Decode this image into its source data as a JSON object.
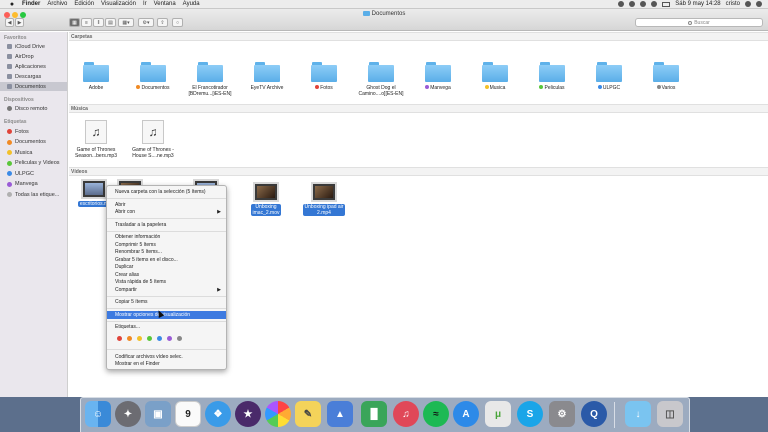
{
  "menubar": {
    "app": "Finder",
    "items": [
      "Archivo",
      "Edición",
      "Visualización",
      "Ir",
      "Ventana",
      "Ayuda"
    ],
    "clock": "Sáb 9 may 14:28",
    "user": "cristo"
  },
  "window": {
    "title": "Documentos",
    "search_placeholder": "Buscar"
  },
  "sidebar": {
    "favorites_header": "Favoritos",
    "favorites": [
      "iCloud Drive",
      "AirDrop",
      "Aplicaciones",
      "Descargas",
      "Documentos"
    ],
    "devices_header": "Dispositivos",
    "devices": [
      "Disco remoto"
    ],
    "tags_header": "Etiquetas",
    "tags": [
      {
        "label": "Fotos",
        "color": "#e0443a"
      },
      {
        "label": "Documentos",
        "color": "#f08a24"
      },
      {
        "label": "Musica",
        "color": "#f2c02a"
      },
      {
        "label": "Peliculas y Videos",
        "color": "#5ac63a"
      },
      {
        "label": "ULPGC",
        "color": "#3b8ae6"
      },
      {
        "label": "Manvega",
        "color": "#9a5bd6"
      },
      {
        "label": "Todas las etique...",
        "color": "#b0b0b0"
      }
    ]
  },
  "sections": {
    "folders_header": "Carpetas",
    "music_header": "Música",
    "videos_header": "Vídeos"
  },
  "folders": [
    {
      "l1": "Adobe",
      "l2": "",
      "dot": ""
    },
    {
      "l1": "Documentos",
      "l2": "",
      "dot": "#f08a24"
    },
    {
      "l1": "El Francotirador",
      "l2": "[BDremu...[iES-EN]",
      "dot": ""
    },
    {
      "l1": "EyeTV Archive",
      "l2": "",
      "dot": ""
    },
    {
      "l1": "Fotos",
      "l2": "",
      "dot": "#e0443a"
    },
    {
      "l1": "Ghost Dog el",
      "l2": "Camino....o][ES-EN]",
      "dot": ""
    },
    {
      "l1": "Manvega",
      "l2": "",
      "dot": "#9a5bd6"
    },
    {
      "l1": "Musica",
      "l2": "",
      "dot": "#f2c02a"
    },
    {
      "l1": "Peliculas",
      "l2": "",
      "dot": "#5ac63a"
    },
    {
      "l1": "ULPGC",
      "l2": "",
      "dot": "#3b8ae6"
    },
    {
      "l1": "Varios",
      "l2": "",
      "dot": "#888888"
    }
  ],
  "music": [
    {
      "l1": "Game of Thrones",
      "l2": "Season...bers.mp3"
    },
    {
      "l1": "Game of Thrones -",
      "l2": "House S....ne.mp3"
    }
  ],
  "videos": [
    {
      "l1": "escritorios.m",
      "l2": ""
    },
    {
      "l1": "Unboxing",
      "l2": "imac_2.mov"
    },
    {
      "l1": "Unboxing ipad air",
      "l2": "2.mp4"
    }
  ],
  "context_menu": {
    "items": [
      "Nueva carpeta con la selección (5 ítems)",
      "Abrir",
      "Abrir con",
      "Trasladar a la papelera",
      "Obtener información",
      "Comprimir 5 ítems",
      "Renombrar 5 ítems...",
      "Grabar 5 ítems en el disco...",
      "Duplicar",
      "Crear alias",
      "Vista rápida de 5 ítems",
      "Compartir",
      "Copiar 5 ítems",
      "Mostrar opciones de visualización",
      "Etiquetas...",
      "Codificar archivos vídeo selec.",
      "Mostrar en el Finder"
    ],
    "tag_colors": [
      "#e0443a",
      "#f08a24",
      "#f2c02a",
      "#5ac63a",
      "#3b8ae6",
      "#9a5bd6",
      "#888888"
    ]
  },
  "dock": {
    "calendar_day": "9",
    "items": [
      "finder-icon",
      "launchpad-icon",
      "preview-icon",
      "calendar-icon",
      "safari-icon",
      "imovie-icon",
      "photos-icon",
      "notes-icon",
      "keynote-icon",
      "numbers-icon",
      "itunes-icon",
      "spotify-icon",
      "appstore-icon",
      "utorrent-icon",
      "skype-icon",
      "system-preferences-icon",
      "quicktime-icon",
      "downloads-folder-icon",
      "trash-icon"
    ]
  }
}
